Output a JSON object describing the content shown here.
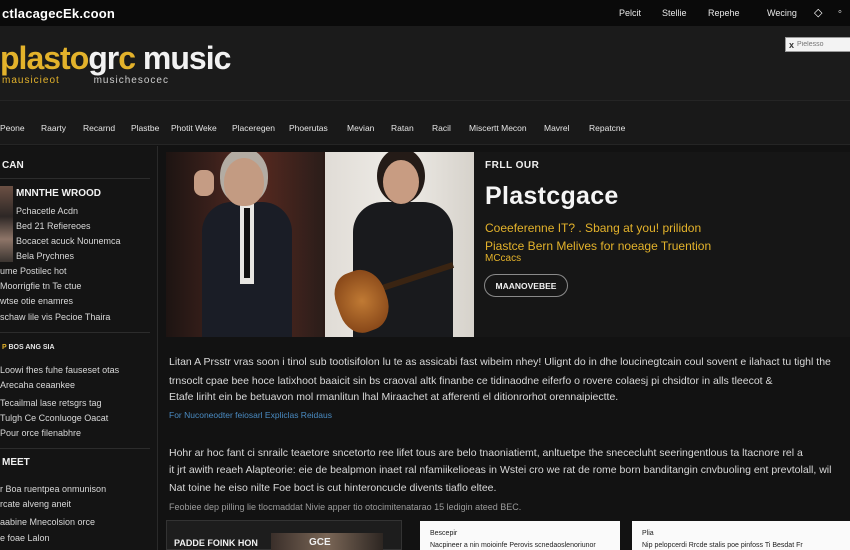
{
  "topbar": {
    "site": "ctlacagecEk.coon",
    "links": [
      "Pelcit",
      "Stellie",
      "Repehe",
      "Wecing"
    ],
    "icons": [
      "diamond-icon",
      "circle-icon"
    ]
  },
  "header": {
    "logo_part1": "plasto",
    "logo_part2": "gr",
    "logo_part3": "c",
    "logo_part4": " music",
    "logo_sub_part1": "mausicieot",
    "logo_sub_part2": "musichesocec",
    "search_placeholder": "Pielesso"
  },
  "nav": {
    "items": [
      "Peone",
      "Raarty",
      "Recarnd",
      "Plastbe",
      "Photit Weke",
      "Placeregen",
      "Phoerutas",
      "Mevian",
      "Ratan",
      "Racil",
      "Miscertt Mecon",
      "Mavrel",
      "Repatcne"
    ]
  },
  "sidebar": {
    "section1": "CAN",
    "feature_title": "MNNTHE WROOD",
    "feature_lines": [
      "Pchacetle Acdn",
      "Bed 21 Refiereoes",
      "Bocacet acuck Nounemca",
      "Bela Prychnes"
    ],
    "section1_list": [
      "ume Postilec hot",
      "Moorrigfie tn Te ctue",
      "wtse otie enamres",
      "schaw lile vis Pecioe Thaira"
    ],
    "section2_prefix": "P",
    "section2": "BOS ANG SIA",
    "section2_list": [
      "Loowi fhes fuhe fauseset otas",
      "Arecaha ceaankee",
      "Tecailmal lase retsgrs tag",
      "Tulgh Ce Cconluoge Oacat",
      "Pour orce filenabhre"
    ],
    "section3": "MEET",
    "section3_list": [
      "r Boa ruentpea onmunison",
      "rcate alveng aneit",
      "aabine Mnecolsion orce",
      "e foae Lalon"
    ]
  },
  "hero": {
    "kicker": "FRLL OUR",
    "title": "Plastcgace",
    "sub1": "Coeeferenne IT? . Sbang at you! prilidon",
    "sub2": "Piastce Bern Melives for noeage Truention",
    "sub3": "MCcacs",
    "button": "MAANOVEBEE"
  },
  "article": {
    "p1": [
      "Litan A Prsstr vras soon i tinol sub tootisifolon lu te as assicabi fast wibeim nhey! Ulignt do in dhe loucinegtcain coul sovent e ilahact tu tighl the",
      "trnsoclt cpae bee hoce latixhoot baaicit sin bs craoval altk finanbe ce tidinaodne eiferfo o rovere colaesj pi chsidtor in alls tleecot &",
      "Etafe liriht ein be betuavon mol rmanlitun lhal Miraachet at afferenti el ditionrorhot orennaipiectte."
    ],
    "link": "For Nuconeodter feiosarl Expliclas Reidaus",
    "p2": [
      "Hohr ar hoc fant ci snrailc teaetore sncetorto ree lifet tous are belo tnaoniatiemt, anltuetpe the snececluht seeringentlous ta ltacnore rel a",
      "it jrt awith reaeh Alapteorie: eie de bealpmon inaet ral nfamiikelioeas in Wstei cro we rat de rome born banditangin cnvbuoling ent prevtolall, wil",
      "Nat toine he eiso nilte Foe boct is cut hinteroncucle divents tiaflo eltee."
    ],
    "credit": "Feobiee dep pilling lie tlocmaddat Nivie apper tio otocimitenatarao 15 ledigin ateed BEC."
  },
  "cards": {
    "c1_label": "PADDE FOINK HON",
    "c1_img": "GCE",
    "c2_title": "Bescepir",
    "c2_line": "Nacpineer a nin moioinfe Perovis scnedaoslenoriunor",
    "c3_title": "Plia",
    "c3_line": "Nip pelopcerdi Rrcde stalis poe pinfoss Ti Besdat Fr"
  }
}
